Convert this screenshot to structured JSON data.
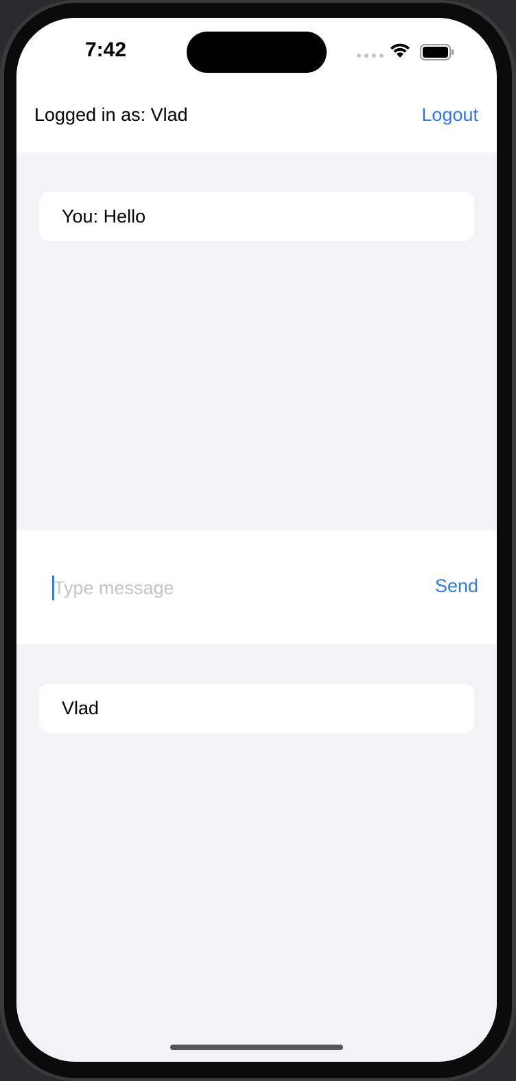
{
  "status_bar": {
    "time": "7:42",
    "icons": [
      "signal-dots-icon",
      "wifi-icon",
      "battery-icon"
    ]
  },
  "header": {
    "logged_in_label": "Logged in as: Vlad",
    "logout_label": "Logout"
  },
  "messages": [
    {
      "text": "You: Hello"
    }
  ],
  "composer": {
    "placeholder": "Type message",
    "value": "",
    "send_label": "Send"
  },
  "users": [
    {
      "name": "Vlad"
    }
  ],
  "colors": {
    "accent": "#2f7ae5",
    "background": "#f2f2f7",
    "card": "#ffffff",
    "placeholder": "#c4c4c7"
  }
}
